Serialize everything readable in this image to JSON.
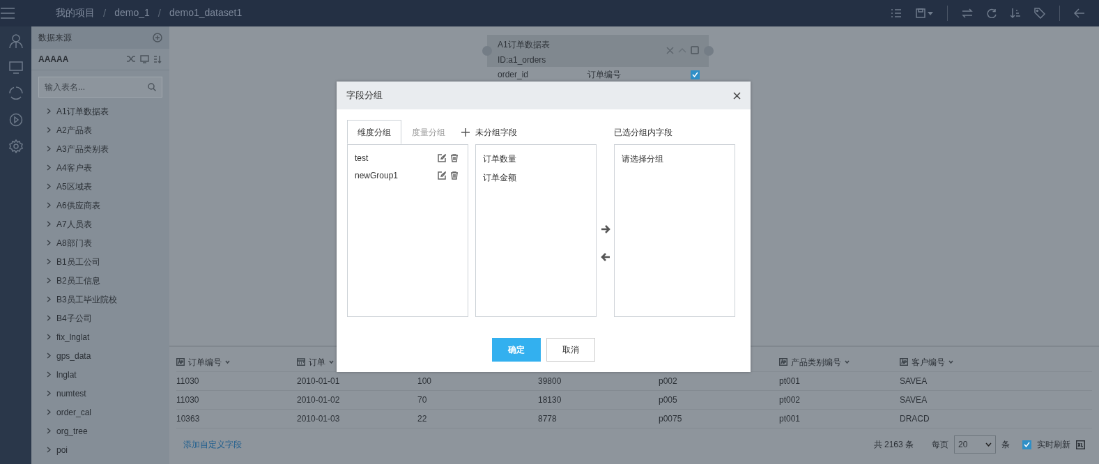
{
  "topbar": {
    "breadcrumb": [
      {
        "kind": "crumb",
        "text": "我的项目"
      },
      {
        "kind": "separator",
        "text": "/"
      },
      {
        "kind": "crumb",
        "text": "demo_1"
      },
      {
        "kind": "separator",
        "text": "/"
      },
      {
        "kind": "crumb",
        "text": "demo1_dataset1"
      }
    ]
  },
  "sidebar": {
    "title": "数据来源",
    "dataset": "AAAAA",
    "search": {
      "placeholder": "输入表名..."
    },
    "tables": [
      "A1订单数据表",
      "A2产品表",
      "A3产品类别表",
      "A4客户表",
      "A5区域表",
      "A6供应商表",
      "A7人员表",
      "A8部门表",
      "B1员工公司",
      "B2员工信息",
      "B3员工毕业院校",
      "B4子公司",
      "fix_lnglat",
      "gps_data",
      "lnglat",
      "numtest",
      "order_cal",
      "org_tree",
      "poi"
    ]
  },
  "canvas": {
    "node": {
      "title": "A1订单数据表",
      "id_label": "ID:a1_orders",
      "field": {
        "name": "order_id",
        "label": "订单编号",
        "checked": true
      }
    }
  },
  "dialog": {
    "title": "字段分组",
    "tabs": [
      {
        "label": "维度分组",
        "selected": true
      },
      {
        "label": "度量分组",
        "selected": false
      }
    ],
    "groups": [
      "test",
      "newGroup1"
    ],
    "ungrouped_label": "未分组字段",
    "ungrouped_fields": [
      "订单数量",
      "订单金额"
    ],
    "selected_label": "已选分组内字段",
    "selected_placeholder": "请选择分组",
    "confirm": "确定",
    "cancel": "取消"
  },
  "table": {
    "header_left": [
      {
        "label": "订单编号",
        "kind": "text"
      },
      {
        "label": "订单",
        "kind": "date"
      }
    ],
    "header_right": [
      {
        "label": "产品类别编号",
        "kind": "text"
      },
      {
        "label": "客户编号",
        "kind": "text"
      }
    ],
    "rows": [
      [
        "11030",
        "2010-01-01",
        "100",
        "39800",
        "p002",
        "pt001",
        "SAVEA"
      ],
      [
        "11030",
        "2010-01-02",
        "70",
        "18130",
        "p005",
        "pt002",
        "SAVEA"
      ],
      [
        "10363",
        "2010-01-03",
        "22",
        "8778",
        "p0075",
        "pt001",
        "DRACD"
      ]
    ]
  },
  "footer": {
    "add_field": "添加自定义字段",
    "total": "共 2163 条",
    "per_page_label": "每页",
    "per_page": "20",
    "per_page_unit": "条",
    "realtime": {
      "label": "实时刷新",
      "checked": true
    }
  }
}
